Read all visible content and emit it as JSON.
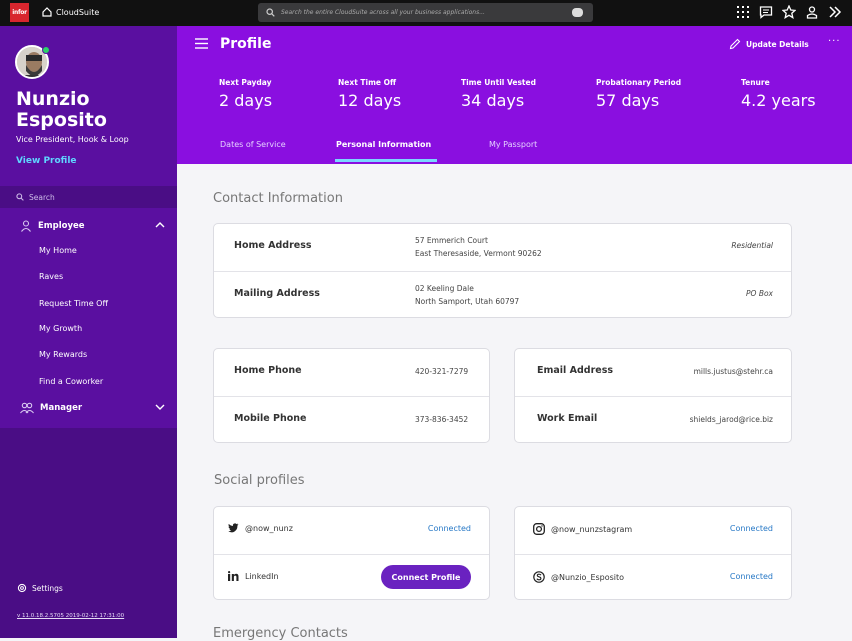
{
  "topbar": {
    "logo": "infor",
    "app_name": "CloudSuite",
    "search_placeholder": "Search the entire CloudSuite across all your business applications...",
    "icons": [
      "grid-icon",
      "chat-icon",
      "star-icon",
      "user-icon",
      "expand-icon"
    ]
  },
  "sidebar": {
    "user_name": "Nunzio Esposito",
    "user_title": "Vice President, Hook & Loop",
    "view_profile": "View Profile",
    "search_label": "Search",
    "employee": {
      "label": "Employee",
      "items": [
        "My Home",
        "Raves",
        "Request Time Off",
        "My Growth",
        "My Rewards",
        "Find a Coworker"
      ]
    },
    "manager": {
      "label": "Manager"
    },
    "settings": "Settings",
    "version": "v 11.0.18.2.5705 2019-02-12 17:31:00"
  },
  "header": {
    "title": "Profile",
    "update_details": "Update Details",
    "more": "···",
    "stats": [
      {
        "label": "Next Payday",
        "value": "2 days"
      },
      {
        "label": "Next Time Off",
        "value": "12 days"
      },
      {
        "label": "Time Until Vested",
        "value": "34 days"
      },
      {
        "label": "Probationary Period",
        "value": "57 days"
      },
      {
        "label": "Tenure",
        "value": "4.2 years"
      }
    ],
    "tabs": [
      "Dates of Service",
      "Personal Information",
      "My Passport"
    ],
    "active_tab": "Personal Information"
  },
  "contact": {
    "heading": "Contact Information",
    "addresses": [
      {
        "label": "Home Address",
        "line1": "57 Emmerich Court",
        "line2": "East Theresaside, Vermont 90262",
        "type": "Residential"
      },
      {
        "label": "Mailing Address",
        "line1": "02 Keeling Dale",
        "line2": "North Samport, Utah 60797",
        "type": "PO Box"
      }
    ],
    "phones": [
      {
        "label": "Home Phone",
        "value": "420-321-7279"
      },
      {
        "label": "Mobile Phone",
        "value": "373-836-3452"
      }
    ],
    "emails": [
      {
        "label": "Email Address",
        "value": "mills.justus@stehr.ca"
      },
      {
        "label": "Work Email",
        "value": "shields_jarod@rice.biz"
      }
    ]
  },
  "social": {
    "heading": "Social profiles",
    "left": [
      {
        "handle": "@now_nunz",
        "icon": "twitter-icon",
        "status": "Connected"
      },
      {
        "handle": "LinkedIn",
        "icon": "linkedin-icon",
        "action": "Connect Profile"
      }
    ],
    "right": [
      {
        "handle": "@now_nunzstagram",
        "icon": "instagram-icon",
        "status": "Connected"
      },
      {
        "handle": "@Nunzio_Esposito",
        "icon": "skype-icon",
        "status": "Connected"
      }
    ]
  },
  "emergency": {
    "heading": "Emergency Contacts"
  },
  "colors": {
    "header_purple": "#8a0fe0",
    "sidebar_purple": "#5a0fa0",
    "accent_blue": "#2778c6",
    "button_purple": "#6a22c0"
  }
}
